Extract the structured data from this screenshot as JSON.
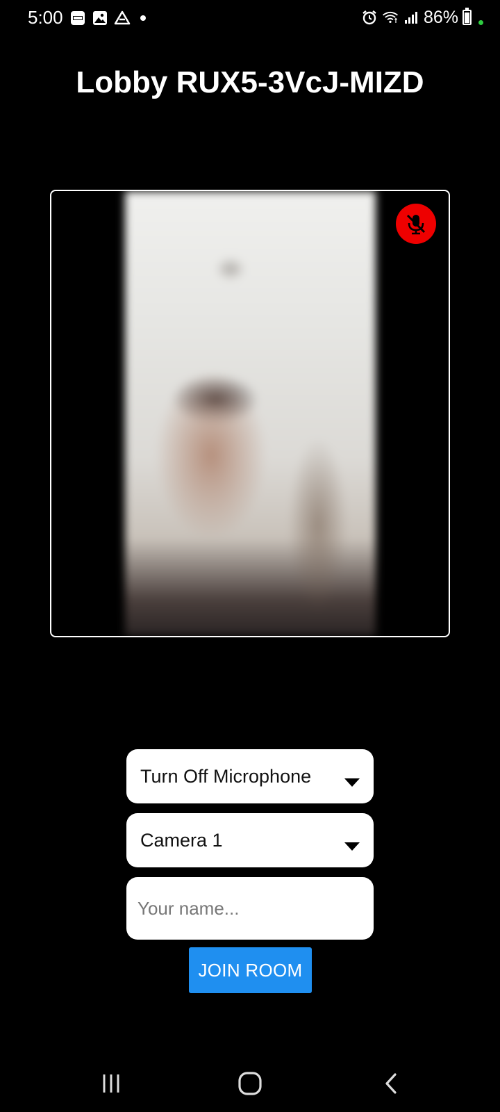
{
  "status_bar": {
    "time": "5:00",
    "left_icons": [
      "klook-icon",
      "image-icon",
      "drive-icon"
    ],
    "battery_text": "86%",
    "battery_level": 0.86
  },
  "lobby": {
    "title": "Lobby RUX5-3VcJ-MIZD"
  },
  "video": {
    "mic_muted": true,
    "mic_badge_color": "#ee0000"
  },
  "controls": {
    "microphone_select": {
      "selected": "Turn Off Microphone"
    },
    "camera_select": {
      "selected": "Camera 1"
    },
    "name_input": {
      "value": "",
      "placeholder": "Your name..."
    },
    "join_label": "JOIN ROOM",
    "join_color": "#1f8ff0"
  },
  "nav_bar": {
    "buttons": [
      "recent-apps-icon",
      "home-icon",
      "back-icon"
    ]
  }
}
